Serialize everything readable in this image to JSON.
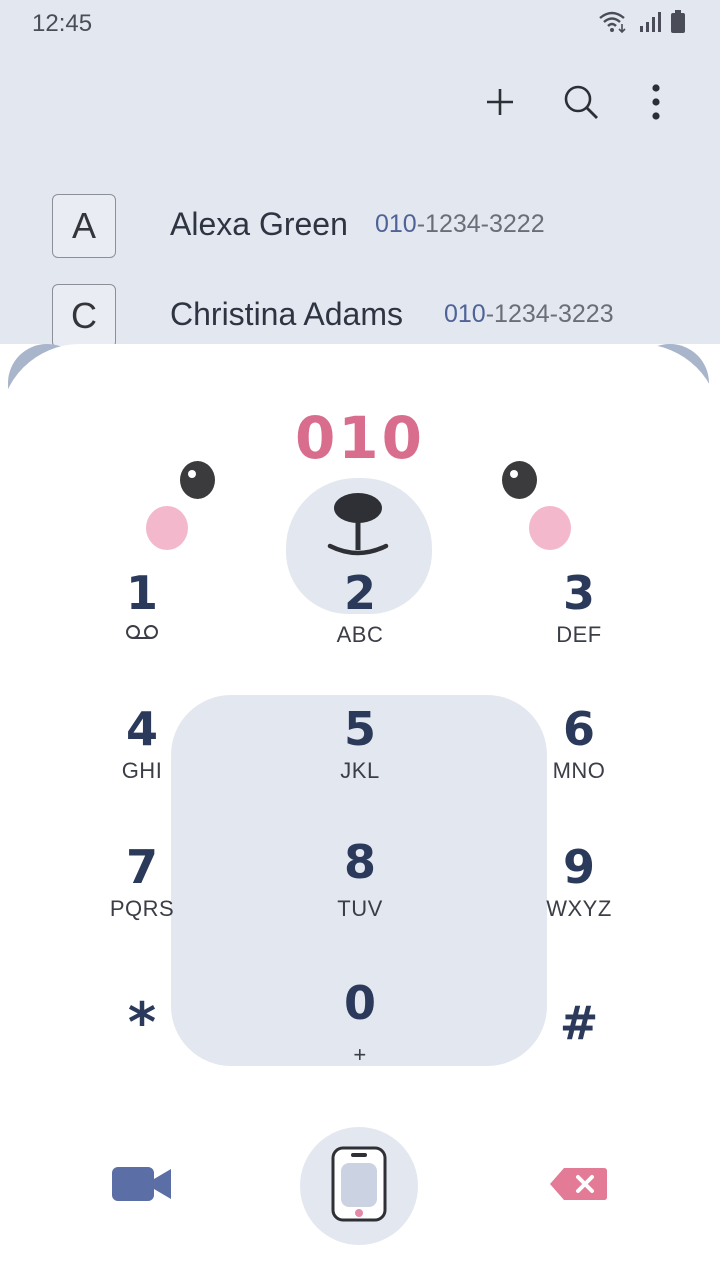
{
  "status_bar": {
    "time": "12:45"
  },
  "toolbar": {
    "add_icon": "plus-icon",
    "search_icon": "search-icon",
    "more_icon": "more-vertical-icon"
  },
  "contacts": [
    {
      "letter": "A",
      "name": "Alexa Green",
      "number_match": "010",
      "number_rest": "-1234-3222"
    },
    {
      "letter": "C",
      "name": "Christina Adams",
      "number_match": "010",
      "number_rest": "-1234-3223"
    }
  ],
  "dial_input": "010",
  "keypad": {
    "k1": {
      "digit": "1",
      "sub_icon": "voicemail-icon"
    },
    "k2": {
      "digit": "2",
      "letters": "ABC"
    },
    "k3": {
      "digit": "3",
      "letters": "DEF"
    },
    "k4": {
      "digit": "4",
      "letters": "GHI"
    },
    "k5": {
      "digit": "5",
      "letters": "JKL"
    },
    "k6": {
      "digit": "6",
      "letters": "MNO"
    },
    "k7": {
      "digit": "7",
      "letters": "PQRS"
    },
    "k8": {
      "digit": "8",
      "letters": "TUV"
    },
    "k9": {
      "digit": "9",
      "letters": "WXYZ"
    },
    "kstar": {
      "digit": "*"
    },
    "k0": {
      "digit": "0",
      "letters": "+"
    },
    "khash": {
      "digit": "#"
    }
  },
  "actions": {
    "video_call": "video-camera-icon",
    "voice_call": "phone-icon",
    "backspace": "backspace-icon"
  },
  "colors": {
    "accent_pink": "#d96d8e",
    "digit_navy": "#2b3a5a",
    "match_blue": "#4f6398",
    "panel_gray": "#e3e7ef",
    "video_blue": "#5b6ea6"
  }
}
